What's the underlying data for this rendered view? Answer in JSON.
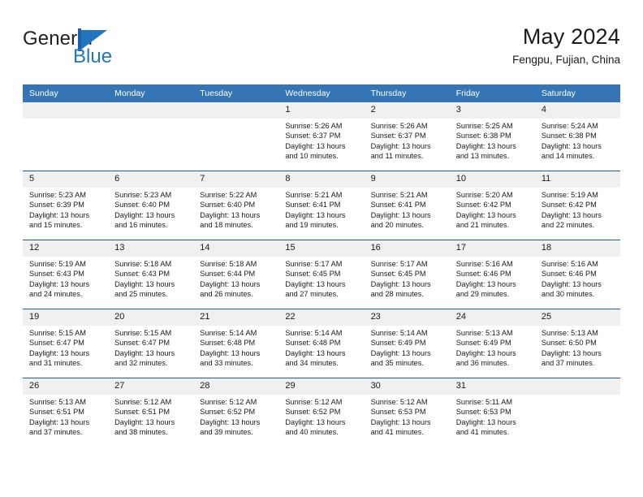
{
  "brand": {
    "name_part1": "General",
    "name_part2": "Blue",
    "mark": "sail-triangle",
    "accent_color": "#2176bd"
  },
  "header": {
    "title": "May 2024",
    "location": "Fengpu, Fujian, China"
  },
  "colors": {
    "header_blue": "#3575b5",
    "rule_blue": "#1f5c99",
    "daynum_gray": "#f0f0f0"
  },
  "weekday_headers": [
    "Sunday",
    "Monday",
    "Tuesday",
    "Wednesday",
    "Thursday",
    "Friday",
    "Saturday"
  ],
  "labels": {
    "sunrise": "Sunrise:",
    "sunset": "Sunset:",
    "daylight": "Daylight:"
  },
  "weeks": [
    [
      {
        "day": "",
        "blank": true
      },
      {
        "day": "",
        "blank": true
      },
      {
        "day": "",
        "blank": true
      },
      {
        "day": "1",
        "sunrise": "Sunrise: 5:26 AM",
        "sunset": "Sunset: 6:37 PM",
        "daylight_line1": "Daylight: 13 hours",
        "daylight_line2": "and 10 minutes."
      },
      {
        "day": "2",
        "sunrise": "Sunrise: 5:26 AM",
        "sunset": "Sunset: 6:37 PM",
        "daylight_line1": "Daylight: 13 hours",
        "daylight_line2": "and 11 minutes."
      },
      {
        "day": "3",
        "sunrise": "Sunrise: 5:25 AM",
        "sunset": "Sunset: 6:38 PM",
        "daylight_line1": "Daylight: 13 hours",
        "daylight_line2": "and 13 minutes."
      },
      {
        "day": "4",
        "sunrise": "Sunrise: 5:24 AM",
        "sunset": "Sunset: 6:38 PM",
        "daylight_line1": "Daylight: 13 hours",
        "daylight_line2": "and 14 minutes."
      }
    ],
    [
      {
        "day": "5",
        "sunrise": "Sunrise: 5:23 AM",
        "sunset": "Sunset: 6:39 PM",
        "daylight_line1": "Daylight: 13 hours",
        "daylight_line2": "and 15 minutes."
      },
      {
        "day": "6",
        "sunrise": "Sunrise: 5:23 AM",
        "sunset": "Sunset: 6:40 PM",
        "daylight_line1": "Daylight: 13 hours",
        "daylight_line2": "and 16 minutes."
      },
      {
        "day": "7",
        "sunrise": "Sunrise: 5:22 AM",
        "sunset": "Sunset: 6:40 PM",
        "daylight_line1": "Daylight: 13 hours",
        "daylight_line2": "and 18 minutes."
      },
      {
        "day": "8",
        "sunrise": "Sunrise: 5:21 AM",
        "sunset": "Sunset: 6:41 PM",
        "daylight_line1": "Daylight: 13 hours",
        "daylight_line2": "and 19 minutes."
      },
      {
        "day": "9",
        "sunrise": "Sunrise: 5:21 AM",
        "sunset": "Sunset: 6:41 PM",
        "daylight_line1": "Daylight: 13 hours",
        "daylight_line2": "and 20 minutes."
      },
      {
        "day": "10",
        "sunrise": "Sunrise: 5:20 AM",
        "sunset": "Sunset: 6:42 PM",
        "daylight_line1": "Daylight: 13 hours",
        "daylight_line2": "and 21 minutes."
      },
      {
        "day": "11",
        "sunrise": "Sunrise: 5:19 AM",
        "sunset": "Sunset: 6:42 PM",
        "daylight_line1": "Daylight: 13 hours",
        "daylight_line2": "and 22 minutes."
      }
    ],
    [
      {
        "day": "12",
        "sunrise": "Sunrise: 5:19 AM",
        "sunset": "Sunset: 6:43 PM",
        "daylight_line1": "Daylight: 13 hours",
        "daylight_line2": "and 24 minutes."
      },
      {
        "day": "13",
        "sunrise": "Sunrise: 5:18 AM",
        "sunset": "Sunset: 6:43 PM",
        "daylight_line1": "Daylight: 13 hours",
        "daylight_line2": "and 25 minutes."
      },
      {
        "day": "14",
        "sunrise": "Sunrise: 5:18 AM",
        "sunset": "Sunset: 6:44 PM",
        "daylight_line1": "Daylight: 13 hours",
        "daylight_line2": "and 26 minutes."
      },
      {
        "day": "15",
        "sunrise": "Sunrise: 5:17 AM",
        "sunset": "Sunset: 6:45 PM",
        "daylight_line1": "Daylight: 13 hours",
        "daylight_line2": "and 27 minutes."
      },
      {
        "day": "16",
        "sunrise": "Sunrise: 5:17 AM",
        "sunset": "Sunset: 6:45 PM",
        "daylight_line1": "Daylight: 13 hours",
        "daylight_line2": "and 28 minutes."
      },
      {
        "day": "17",
        "sunrise": "Sunrise: 5:16 AM",
        "sunset": "Sunset: 6:46 PM",
        "daylight_line1": "Daylight: 13 hours",
        "daylight_line2": "and 29 minutes."
      },
      {
        "day": "18",
        "sunrise": "Sunrise: 5:16 AM",
        "sunset": "Sunset: 6:46 PM",
        "daylight_line1": "Daylight: 13 hours",
        "daylight_line2": "and 30 minutes."
      }
    ],
    [
      {
        "day": "19",
        "sunrise": "Sunrise: 5:15 AM",
        "sunset": "Sunset: 6:47 PM",
        "daylight_line1": "Daylight: 13 hours",
        "daylight_line2": "and 31 minutes."
      },
      {
        "day": "20",
        "sunrise": "Sunrise: 5:15 AM",
        "sunset": "Sunset: 6:47 PM",
        "daylight_line1": "Daylight: 13 hours",
        "daylight_line2": "and 32 minutes."
      },
      {
        "day": "21",
        "sunrise": "Sunrise: 5:14 AM",
        "sunset": "Sunset: 6:48 PM",
        "daylight_line1": "Daylight: 13 hours",
        "daylight_line2": "and 33 minutes."
      },
      {
        "day": "22",
        "sunrise": "Sunrise: 5:14 AM",
        "sunset": "Sunset: 6:48 PM",
        "daylight_line1": "Daylight: 13 hours",
        "daylight_line2": "and 34 minutes."
      },
      {
        "day": "23",
        "sunrise": "Sunrise: 5:14 AM",
        "sunset": "Sunset: 6:49 PM",
        "daylight_line1": "Daylight: 13 hours",
        "daylight_line2": "and 35 minutes."
      },
      {
        "day": "24",
        "sunrise": "Sunrise: 5:13 AM",
        "sunset": "Sunset: 6:49 PM",
        "daylight_line1": "Daylight: 13 hours",
        "daylight_line2": "and 36 minutes."
      },
      {
        "day": "25",
        "sunrise": "Sunrise: 5:13 AM",
        "sunset": "Sunset: 6:50 PM",
        "daylight_line1": "Daylight: 13 hours",
        "daylight_line2": "and 37 minutes."
      }
    ],
    [
      {
        "day": "26",
        "sunrise": "Sunrise: 5:13 AM",
        "sunset": "Sunset: 6:51 PM",
        "daylight_line1": "Daylight: 13 hours",
        "daylight_line2": "and 37 minutes."
      },
      {
        "day": "27",
        "sunrise": "Sunrise: 5:12 AM",
        "sunset": "Sunset: 6:51 PM",
        "daylight_line1": "Daylight: 13 hours",
        "daylight_line2": "and 38 minutes."
      },
      {
        "day": "28",
        "sunrise": "Sunrise: 5:12 AM",
        "sunset": "Sunset: 6:52 PM",
        "daylight_line1": "Daylight: 13 hours",
        "daylight_line2": "and 39 minutes."
      },
      {
        "day": "29",
        "sunrise": "Sunrise: 5:12 AM",
        "sunset": "Sunset: 6:52 PM",
        "daylight_line1": "Daylight: 13 hours",
        "daylight_line2": "and 40 minutes."
      },
      {
        "day": "30",
        "sunrise": "Sunrise: 5:12 AM",
        "sunset": "Sunset: 6:53 PM",
        "daylight_line1": "Daylight: 13 hours",
        "daylight_line2": "and 41 minutes."
      },
      {
        "day": "31",
        "sunrise": "Sunrise: 5:11 AM",
        "sunset": "Sunset: 6:53 PM",
        "daylight_line1": "Daylight: 13 hours",
        "daylight_line2": "and 41 minutes."
      },
      {
        "day": "",
        "blank": true
      }
    ]
  ]
}
